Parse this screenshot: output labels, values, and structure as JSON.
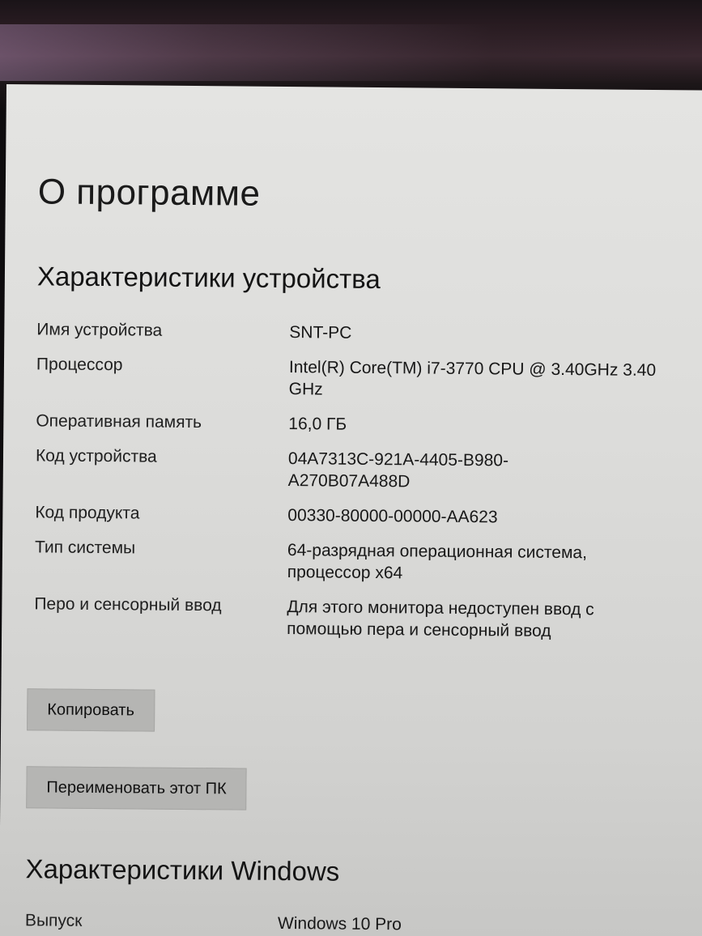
{
  "page_title": "О программе",
  "device_specs": {
    "heading": "Характеристики устройства",
    "rows": [
      {
        "label": "Имя устройства",
        "value": "SNT-PC"
      },
      {
        "label": "Процессор",
        "value": "Intel(R) Core(TM) i7-3770 CPU @ 3.40GHz 3.40 GHz"
      },
      {
        "label": "Оперативная память",
        "value": "16,0 ГБ"
      },
      {
        "label": "Код устройства",
        "value": "04A7313C-921A-4405-B980-A270B07A488D"
      },
      {
        "label": "Код продукта",
        "value": "00330-80000-00000-AA623"
      },
      {
        "label": "Тип системы",
        "value": "64-разрядная операционная система, процессор x64"
      },
      {
        "label": "Перо и сенсорный ввод",
        "value": "Для этого монитора недоступен ввод с помощью пера и сенсорный ввод"
      }
    ]
  },
  "buttons": {
    "copy_label": "Копировать",
    "rename_label": "Переименовать этот ПК"
  },
  "windows_specs": {
    "heading": "Характеристики Windows",
    "rows": [
      {
        "label": "Выпуск",
        "value": "Windows 10 Pro"
      }
    ]
  }
}
